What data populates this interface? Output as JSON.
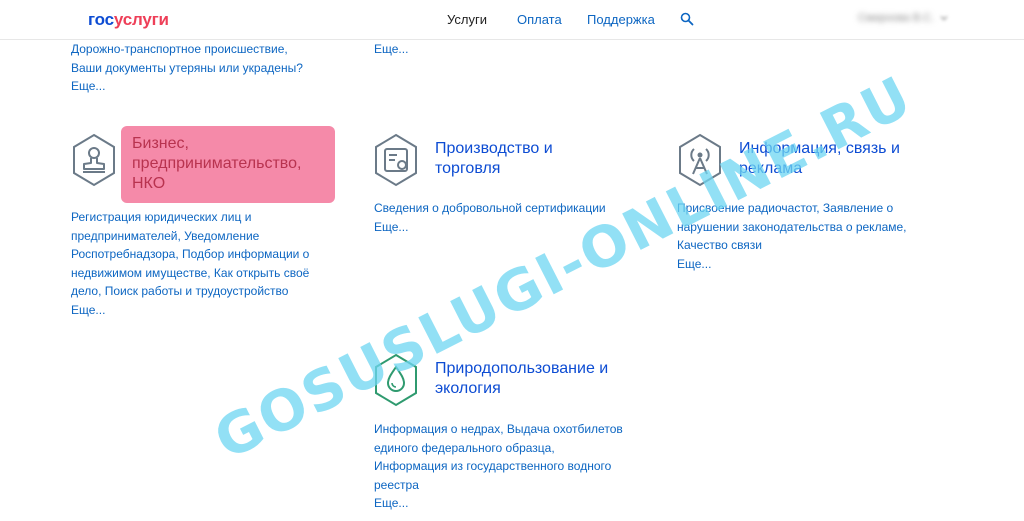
{
  "header": {
    "logo_part1": "гос",
    "logo_part2": "услуги",
    "nav": [
      "Услуги",
      "Оплата",
      "Поддержка"
    ],
    "user_name": "Смирнова В.С."
  },
  "top_section": {
    "left_links": "Дорожно-транспортное происшествие, Ваши документы утеряны или украдены?",
    "left_more": "Еще...",
    "mid_more": "Еще..."
  },
  "categories": {
    "business": {
      "title": "Бизнес, предпринимательство, НКО",
      "links": "Регистрация юридических лиц и предпринимателей, Уведомление Роспотребнадзора, Подбор информации о недвижимом имуществе, Как открыть своё дело, Поиск работы и трудоустройство",
      "more": "Еще..."
    },
    "production": {
      "title": "Производство и торговля",
      "links": "Сведения о добровольной сертификации",
      "more": "Еще..."
    },
    "info": {
      "title": "Информация, связь и реклама",
      "links": "Присвоение радиочастот, Заявление о нарушении законодательства о рекламе, Качество связи",
      "more": "Еще..."
    },
    "nature": {
      "title": "Природопользование и экология",
      "links": "Информация о недрах, Выдача охотбилетов единого федерального образца, Информация из государственного водного реестра",
      "more": "Еще..."
    }
  },
  "watermark": "GOSUSLUGI-ONLINE.RU",
  "colors": {
    "brand_blue": "#0d4cd3",
    "brand_red": "#ee3f58",
    "link_blue": "#0d66c2",
    "highlight_pink": "#f58aa9",
    "icon_gray": "#6b7a88",
    "icon_green": "#2f9a6f",
    "watermark_cyan": "#6ed6f2"
  },
  "icons": [
    "search-icon",
    "stamp-icon",
    "certificate-icon",
    "antenna-icon",
    "water-drop-icon",
    "chevron-down-icon"
  ]
}
